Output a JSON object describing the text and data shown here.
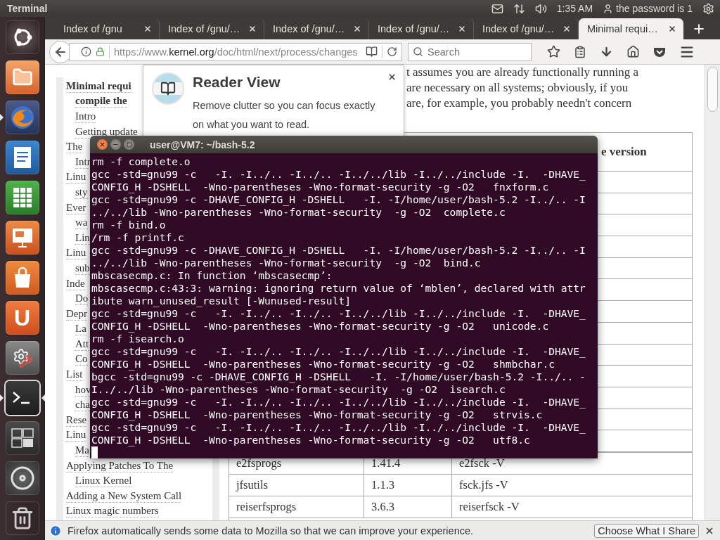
{
  "top_panel": {
    "app_title": "Terminal",
    "clock": "1:35 AM",
    "user": "the password is 1"
  },
  "launcher": {
    "items": [
      {
        "kind": "dash",
        "running": false,
        "focused": false
      },
      {
        "kind": "files",
        "running": false,
        "focused": false
      },
      {
        "kind": "firefox",
        "running": true,
        "focused": false
      },
      {
        "kind": "writer",
        "running": false,
        "focused": false
      },
      {
        "kind": "calc",
        "running": false,
        "focused": false
      },
      {
        "kind": "impress",
        "running": false,
        "focused": false
      },
      {
        "kind": "software",
        "running": false,
        "focused": false
      },
      {
        "kind": "ubuntu-one",
        "label": "U",
        "running": false,
        "focused": false
      },
      {
        "kind": "settings",
        "running": false,
        "focused": false
      },
      {
        "kind": "terminal",
        "running": true,
        "focused": true
      },
      {
        "kind": "workspaces",
        "running": false,
        "focused": false
      },
      {
        "kind": "disc",
        "running": false,
        "focused": false
      },
      {
        "kind": "trash",
        "running": false,
        "focused": false
      }
    ]
  },
  "browser": {
    "tabs": [
      {
        "label": "Index of /gnu",
        "selected": false
      },
      {
        "label": "Index of /gnu/…",
        "selected": false
      },
      {
        "label": "Index of /gnu/…",
        "selected": false
      },
      {
        "label": "Index of /gnu/…",
        "selected": false
      },
      {
        "label": "Index of /gnu/…",
        "selected": false
      },
      {
        "label": "Minimal requi…",
        "selected": true
      }
    ],
    "url": {
      "scheme": "https://www.",
      "domain": "kernel.org",
      "path": "/doc/html/next/process/changes"
    },
    "search": {
      "placeholder": "Search"
    }
  },
  "toc": [
    {
      "label": "Minimal requi",
      "continued": "compile the",
      "bold": true,
      "children": [
        {
          "label": "Intro"
        },
        {
          "label": "Getting update"
        }
      ]
    },
    {
      "label": "The",
      "bold": false,
      "children": [
        {
          "label": "Intr"
        }
      ]
    },
    {
      "label": "Linu",
      "bold": false,
      "children": [
        {
          "label": "sty"
        }
      ]
    },
    {
      "label": "Ever",
      "bold": false,
      "children": [
        {
          "label": "wa"
        },
        {
          "label": "Lin"
        }
      ]
    },
    {
      "label": "Linu",
      "bold": false,
      "children": [
        {
          "label": "sub"
        }
      ]
    },
    {
      "label": "Inde",
      "bold": false,
      "children": [
        {
          "label": "Do"
        }
      ]
    },
    {
      "label": "Depr",
      "bold": false,
      "children": [
        {
          "label": "La"
        },
        {
          "label": "Att"
        },
        {
          "label": "Co"
        }
      ]
    },
    {
      "label": "List",
      "bold": false,
      "children": [
        {
          "label": "hov"
        },
        {
          "label": "cha"
        }
      ]
    },
    {
      "label": "Rese",
      "bold": false
    },
    {
      "label": "Linu",
      "bold": false,
      "children": [
        {
          "label": "Ma"
        }
      ]
    },
    {
      "label": "Applying Patches To The",
      "continued": "Linux Kernel",
      "bold": false
    },
    {
      "label": "Adding a New System Call",
      "bold": false
    },
    {
      "label": "Linux magic numbers",
      "bold": false
    }
  ],
  "intro_lines": [
    "t assumes you are already functionally running a",
    "are necessary on all systems; obviously, if you",
    "are, for example, you probably needn't concern"
  ],
  "table": {
    "header_column_3": "e version",
    "rows": [
      {
        "column_1": "e2fsprogs",
        "column_2": "1.41.4",
        "column_3": "e2fsck -V"
      },
      {
        "column_1": "jfsutils",
        "column_2": "1.1.3",
        "column_3": "fsck.jfs -V"
      },
      {
        "column_1": "reiserfsprogs",
        "column_2": "3.6.3",
        "column_3": "reiserfsck -V"
      }
    ]
  },
  "reader_view_popup": {
    "title": "Reader View",
    "body": "Remove clutter so you can focus exactly on what you want to read."
  },
  "terminal": {
    "title": "user@VM7: ~/bash-5.2",
    "lines": [
      "rm -f complete.o",
      "gcc -std=gnu99 -c   -I. -I../.. -I../.. -I../../lib -I../../include -I.  -DHAVE_",
      "CONFIG_H -DSHELL  -Wno-parentheses -Wno-format-security -g -O2   fnxform.c",
      "gcc -std=gnu99 -c -DHAVE_CONFIG_H -DSHELL   -I. -I/home/user/bash-5.2 -I../.. -I",
      "../../lib -Wno-parentheses -Wno-format-security  -g -O2  complete.c",
      "rm -f bind.o",
      "/rm -f printf.c",
      "gcc -std=gnu99 -c -DHAVE_CONFIG_H -DSHELL   -I. -I/home/user/bash-5.2 -I../.. -I",
      "../../lib -Wno-parentheses -Wno-format-security  -g -O2  bind.c",
      "mbscasecmp.c: In function ‘mbscasecmp’:",
      "mbscasecmp.c:43:3: warning: ignoring return value of ‘mblen’, declared with attr",
      "ibute warn_unused_result [-Wunused-result]",
      "gcc -std=gnu99 -c   -I. -I../.. -I../.. -I../../lib -I../../include -I.  -DHAVE_",
      "CONFIG_H -DSHELL  -Wno-parentheses -Wno-format-security -g -O2   unicode.c",
      "rm -f isearch.o",
      "gcc -std=gnu99 -c   -I. -I../.. -I../.. -I../../lib -I../../include -I.  -DHAVE_",
      "CONFIG_H -DSHELL  -Wno-parentheses -Wno-format-security -g -O2   shmbchar.c",
      "bgcc -std=gnu99 -c -DHAVE_CONFIG_H -DSHELL   -I. -I/home/user/bash-5.2 -I../.. -",
      "I../../lib -Wno-parentheses -Wno-format-security  -g -O2  isearch.c",
      "gcc -std=gnu99 -c   -I. -I../.. -I../.. -I../../lib -I../../include -I.  -DHAVE_",
      "CONFIG_H -DSHELL  -Wno-parentheses -Wno-format-security -g -O2   strvis.c",
      "gcc -std=gnu99 -c   -I. -I../.. -I../.. -I../../lib -I../../include -I.  -DHAVE_",
      "CONFIG_H -DSHELL  -Wno-parentheses -Wno-format-security -g -O2   utf8.c"
    ]
  },
  "notification": {
    "text": "Firefox automatically sends some data to Mozilla so that we can improve your experience.",
    "button": "Choose What I Share"
  }
}
